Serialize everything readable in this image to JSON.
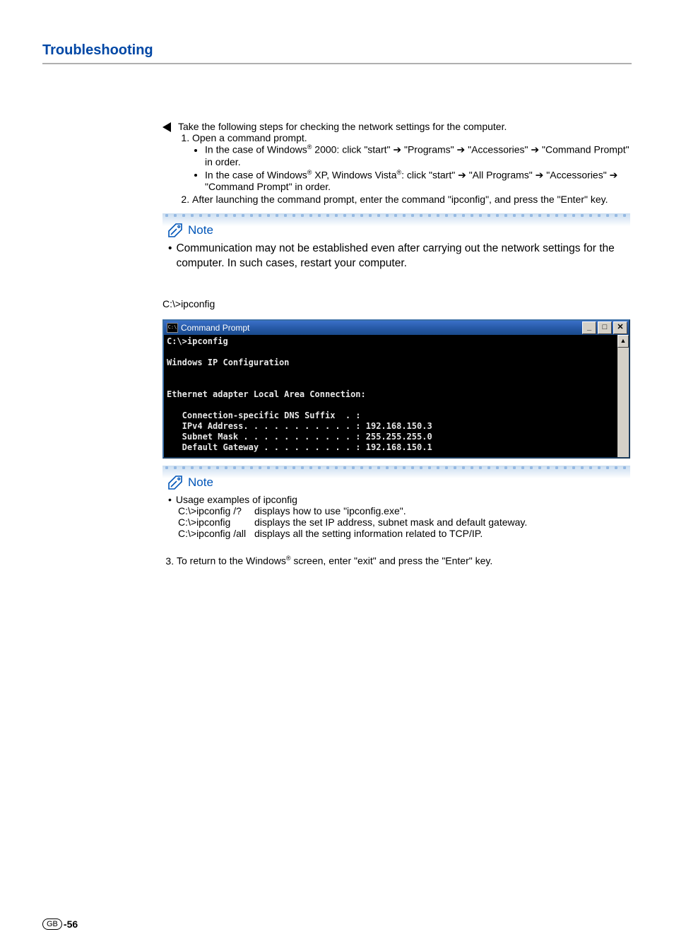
{
  "section_title": "Troubleshooting",
  "intro": "Take the following steps for checking the network settings for the computer.",
  "steps": {
    "s1": "Open a command prompt.",
    "s1a_pre": "In the case of Windows",
    "s1a_post": " 2000: click \"start\" ➔ \"Programs\" ➔ \"Accessories\" ➔ \"Command Prompt\" in order.",
    "s1b_pre": "In the case of Windows",
    "s1b_mid": " XP, Windows Vista",
    "s1b_post": ": click \"start\" ➔ \"All Programs\" ➔ \"Accessories\" ➔ \"Command Prompt\" in order.",
    "s2": "After launching the command prompt, enter the command \"ipconfig\", and press the \"Enter\" key.",
    "s3_pre": "To return to the Windows",
    "s3_post": " screen, enter \"exit\" and press the \"Enter\" key."
  },
  "note1": {
    "label": "Note",
    "text": "Communication may not be established even after carrying out the network settings for the computer. In such cases, restart your computer."
  },
  "cmd_label": "C:\\>ipconfig",
  "cmd_window": {
    "title": "Command Prompt",
    "icon_text": "C:\\",
    "min": "_",
    "max": "□",
    "close": "✕",
    "up": "▲",
    "body": "C:\\>ipconfig\n\nWindows IP Configuration\n\n\nEthernet adapter Local Area Connection:\n\n   Connection-specific DNS Suffix  . :\n   IPv4 Address. . . . . . . . . . . : 192.168.150.3\n   Subnet Mask . . . . . . . . . . . : 255.255.255.0\n   Default Gateway . . . . . . . . . : 192.168.150.1"
  },
  "note2": {
    "label": "Note",
    "heading": "Usage examples of ipconfig",
    "rows": [
      {
        "cmd": "C:\\>ipconfig /?",
        "desc": "displays how to use \"ipconfig.exe\"."
      },
      {
        "cmd": "C:\\>ipconfig",
        "desc": "displays the set IP address, subnet mask and default gateway."
      },
      {
        "cmd": "C:\\>ipconfig /all",
        "desc": "displays all the setting information related to TCP/IP."
      }
    ]
  },
  "footer": {
    "badge": "GB",
    "page": "-56"
  }
}
